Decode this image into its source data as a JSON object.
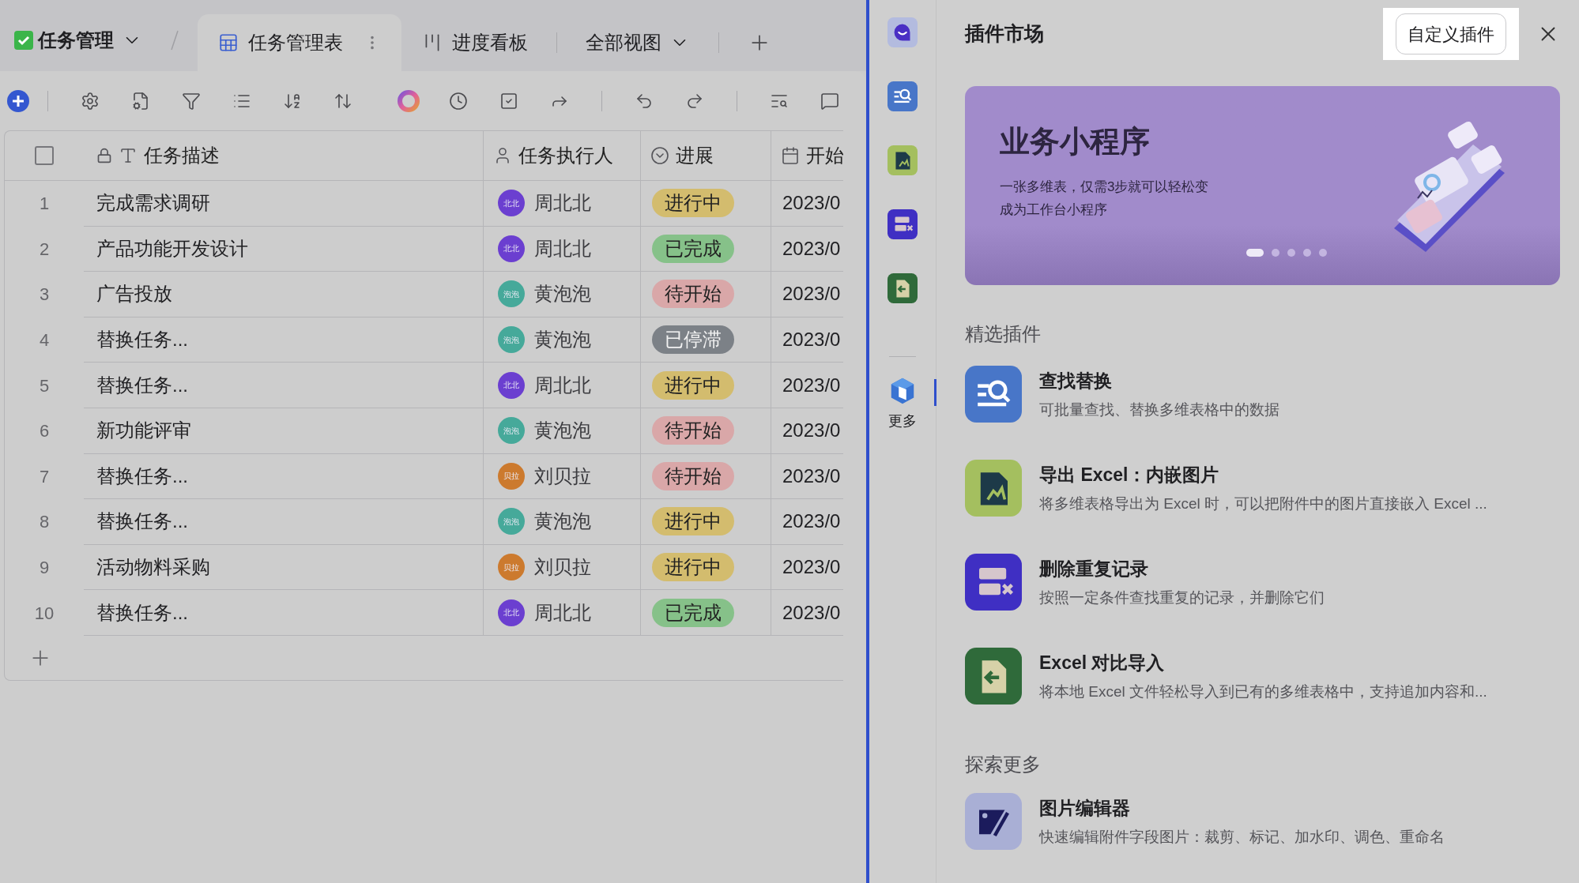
{
  "app": {
    "title": "任务管理"
  },
  "tabs": [
    {
      "label": "任务管理表",
      "selected": true
    },
    {
      "label": "进度看板",
      "selected": false
    }
  ],
  "view_selector": {
    "label": "全部视图"
  },
  "table": {
    "header_checkbox": {
      "checked": false
    },
    "columns": [
      "任务描述",
      "任务执行人",
      "进展",
      "开始"
    ],
    "rows": [
      {
        "number": "1",
        "description": "完成需求调研",
        "assignee": {
          "avatar": "北北",
          "name": "周北北",
          "color": "#6b3fd0"
        },
        "status": {
          "label": "进行中",
          "color": "#d3bc6e"
        },
        "start": "2023/0"
      },
      {
        "number": "2",
        "description": "产品功能开发设计",
        "assignee": {
          "avatar": "北北",
          "name": "周北北",
          "color": "#6b3fd0"
        },
        "status": {
          "label": "已完成",
          "color": "#86c189"
        },
        "start": "2023/0"
      },
      {
        "number": "3",
        "description": "广告投放",
        "assignee": {
          "avatar": "泡泡",
          "name": "黄泡泡",
          "color": "#46a99a"
        },
        "status": {
          "label": "待开始",
          "color": "#d9a7a8"
        },
        "start": "2023/0"
      },
      {
        "number": "4",
        "description": "替换任务...",
        "assignee": {
          "avatar": "泡泡",
          "name": "黄泡泡",
          "color": "#46a99a"
        },
        "status": {
          "label": "已停滞",
          "color": "#7c8187"
        },
        "start": "2023/0"
      },
      {
        "number": "5",
        "description": "替换任务...",
        "assignee": {
          "avatar": "北北",
          "name": "周北北",
          "color": "#6b3fd0"
        },
        "status": {
          "label": "进行中",
          "color": "#d3bc6e"
        },
        "start": "2023/0"
      },
      {
        "number": "6",
        "description": "新功能评审",
        "assignee": {
          "avatar": "泡泡",
          "name": "黄泡泡",
          "color": "#46a99a"
        },
        "status": {
          "label": "待开始",
          "color": "#d9a7a8"
        },
        "start": "2023/0"
      },
      {
        "number": "7",
        "description": "替换任务...",
        "assignee": {
          "avatar": "贝拉",
          "name": "刘贝拉",
          "color": "#cc7a2e"
        },
        "status": {
          "label": "待开始",
          "color": "#d9a7a8"
        },
        "start": "2023/0"
      },
      {
        "number": "8",
        "description": "替换任务...",
        "assignee": {
          "avatar": "泡泡",
          "name": "黄泡泡",
          "color": "#46a99a"
        },
        "status": {
          "label": "进行中",
          "color": "#d3bc6e"
        },
        "start": "2023/0"
      },
      {
        "number": "9",
        "description": "活动物料采购",
        "assignee": {
          "avatar": "贝拉",
          "name": "刘贝拉",
          "color": "#cc7a2e"
        },
        "status": {
          "label": "进行中",
          "color": "#d3bc6e"
        },
        "start": "2023/0"
      },
      {
        "number": "10",
        "description": "替换任务...",
        "assignee": {
          "avatar": "北北",
          "name": "周北北",
          "color": "#6b3fd0"
        },
        "status": {
          "label": "已完成",
          "color": "#86c189"
        },
        "start": "2023/0"
      }
    ]
  },
  "rail": {
    "items": [
      {
        "kind": "chat",
        "selected": false
      },
      {
        "kind": "search",
        "selected": false
      },
      {
        "kind": "excel-image",
        "selected": false
      },
      {
        "kind": "dedupe",
        "selected": false
      },
      {
        "kind": "import",
        "selected": false
      },
      {
        "kind": "more",
        "label": "更多",
        "selected": true
      }
    ]
  },
  "panel": {
    "title": "插件市场",
    "custom_button": "自定义插件",
    "banner": {
      "title": "业务小程序",
      "description_lines": [
        "一张多维表，仅需3步就可以轻松变",
        "成为工作台小程序"
      ],
      "dots": [
        {
          "selected": true
        },
        {
          "selected": false
        },
        {
          "selected": false
        },
        {
          "selected": false
        },
        {
          "selected": false
        }
      ]
    },
    "sections": [
      {
        "title": "精选插件",
        "plugins": [
          {
            "kind": "search",
            "name": "查找替换",
            "description": "可批量查找、替换多维表格中的数据"
          },
          {
            "kind": "excel-image",
            "name": "导出 Excel：内嵌图片",
            "description": "将多维表格导出为 Excel 时，可以把附件中的图片直接嵌入 Excel ..."
          },
          {
            "kind": "dedupe",
            "name": "删除重复记录",
            "description": "按照一定条件查找重复的记录，并删除它们"
          },
          {
            "kind": "import",
            "name": "Excel 对比导入",
            "description": "将本地 Excel 文件轻松导入到已有的多维表格中，支持追加内容和..."
          }
        ]
      },
      {
        "title": "探索更多",
        "plugins": [
          {
            "kind": "image-edit",
            "name": "图片编辑器",
            "description": "快速编辑附件字段图片：裁剪、标记、加水印、调色、重命名"
          }
        ]
      }
    ]
  }
}
